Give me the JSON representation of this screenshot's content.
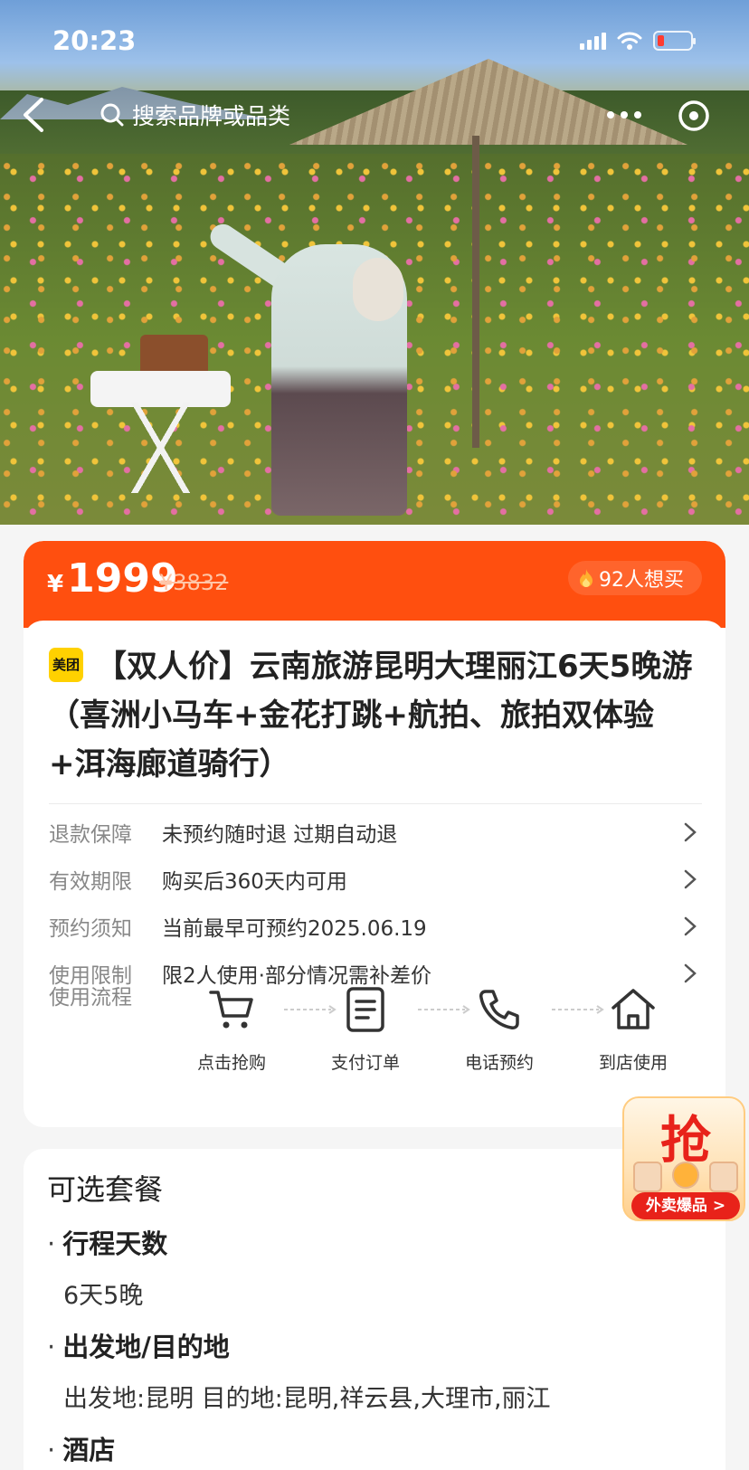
{
  "status_bar": {
    "time": "20:23"
  },
  "nav": {
    "search_placeholder": "搜索品牌或品类"
  },
  "price": {
    "symbol": "¥",
    "current": "1999",
    "original": "¥3832",
    "want_count": "92人想买"
  },
  "product": {
    "brand_tag": "美团",
    "title": "【双人价】云南旅游昆明大理丽江6天5晚游（喜洲小马车+金花打跳+航拍、旅拍双体验+洱海廊道骑行）"
  },
  "info_rows": [
    {
      "label": "退款保障",
      "value": "未预约随时退 过期自动退"
    },
    {
      "label": "有效期限",
      "value": "购买后360天内可用"
    },
    {
      "label": "预约须知",
      "value": "当前最早可预约2025.06.19"
    },
    {
      "label": "使用限制",
      "value": "限2人使用·部分情况需补差价"
    }
  ],
  "flow": {
    "label": "使用流程",
    "steps": [
      {
        "icon": "cart-icon",
        "label": "点击抢购"
      },
      {
        "icon": "order-icon",
        "label": "支付订单"
      },
      {
        "icon": "phone-icon",
        "label": "电话预约"
      },
      {
        "icon": "home-icon",
        "label": "到店使用"
      }
    ]
  },
  "packages": {
    "title": "可选套餐",
    "options": [
      {
        "name": "行程天数",
        "value": "6天5晚"
      },
      {
        "name": "出发地/目的地",
        "value": "出发地:昆明 目的地:昆明,祥云县,大理市,丽江"
      },
      {
        "name": "酒店",
        "value": ""
      }
    ]
  },
  "float_ad": {
    "headline": "抢",
    "button": "外卖爆品 >"
  },
  "colors": {
    "accent": "#ff4f0f",
    "brand_yellow": "#ffd100",
    "ad_red": "#e8221a"
  }
}
